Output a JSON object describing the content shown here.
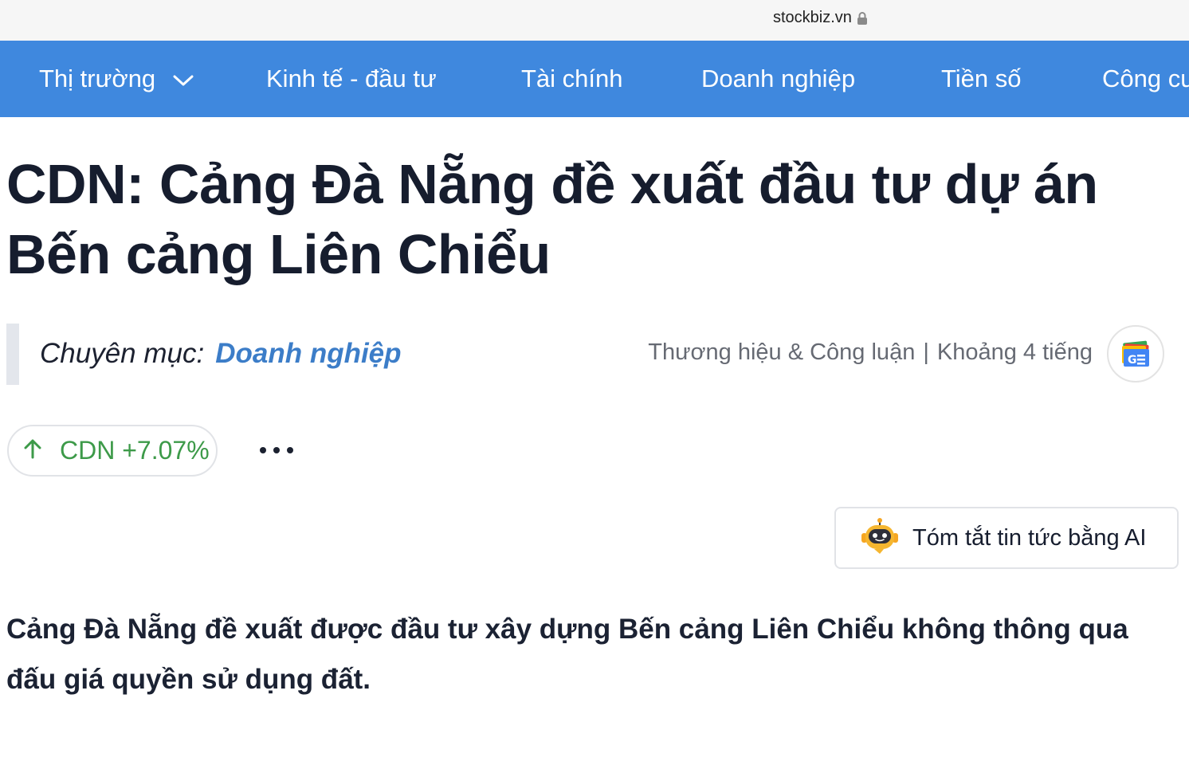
{
  "browser": {
    "domain": "stockbiz.vn",
    "lock_icon": "lock-icon"
  },
  "nav": {
    "background": "#3f88de",
    "items": [
      {
        "label": "Thị trường",
        "has_dropdown": true
      },
      {
        "label": "Kinh tế - đầu tư"
      },
      {
        "label": "Tài chính"
      },
      {
        "label": "Doanh nghiệp"
      },
      {
        "label": "Tiền số"
      },
      {
        "label": "Công cu"
      }
    ]
  },
  "article": {
    "title": "CDN: Cảng Đà Nẵng đề xuất đầu tư dự án Bến cảng Liên Chiểu",
    "category_label": "Chuyên mục:",
    "category_value": "Doanh nghiệp",
    "source": "Thương hiệu & Công luận",
    "separator": "|",
    "time": "Khoảng 4 tiếng",
    "google_news_icon": "google-news-icon",
    "ticker": {
      "symbol": "CDN",
      "change": "+7.07%",
      "direction": "up",
      "color": "#3d9a49"
    },
    "more_icon": "more-dots-icon",
    "ai_summary_label": "Tóm tắt tin tức bằng AI",
    "ai_icon": "robot-icon",
    "lead": "Cảng Đà Nẵng đề xuất được đầu tư xây dựng Bến cảng Liên Chiểu không thông qua đấu giá quyền sử dụng đất."
  }
}
